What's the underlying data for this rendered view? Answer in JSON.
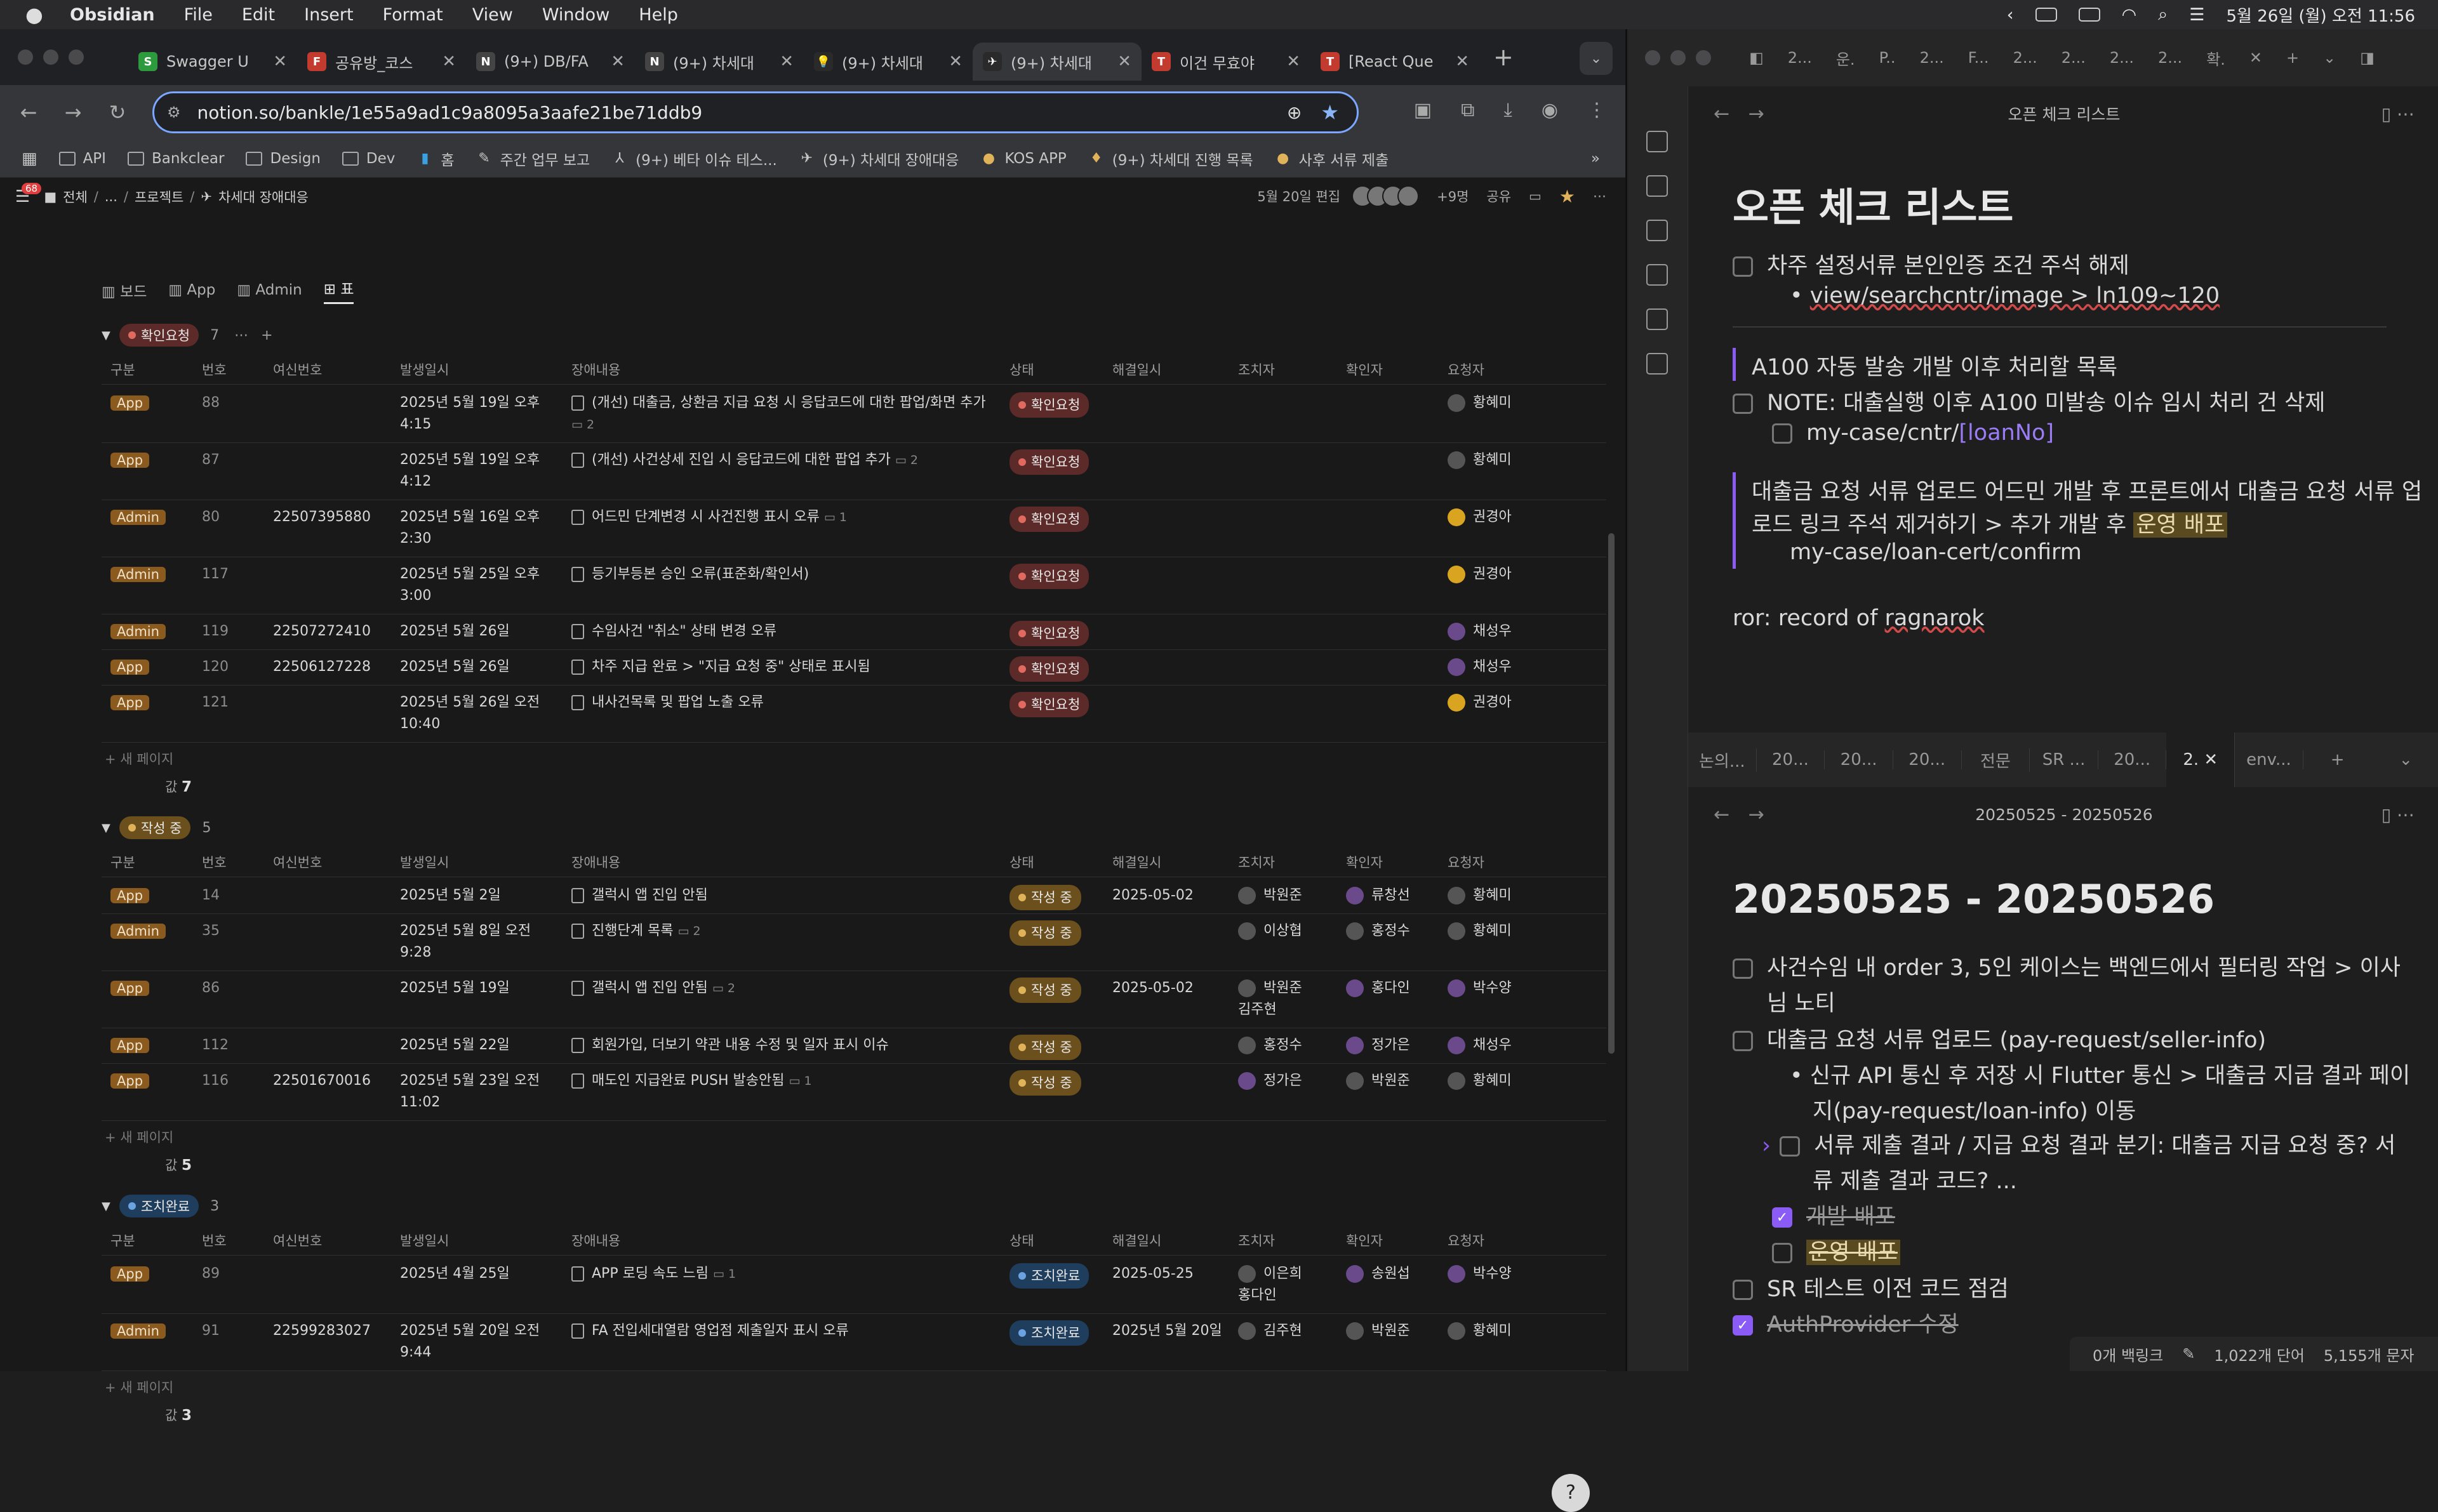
{
  "menubar": {
    "apple": "",
    "app": "Obsidian",
    "items": [
      "File",
      "Edit",
      "Insert",
      "Format",
      "View",
      "Window",
      "Help"
    ],
    "clock": "5월 26일 (월) 오전 11:56"
  },
  "chrome": {
    "tabs": [
      {
        "label": "Swagger U",
        "color": "#2e9a3e",
        "glyph": "S"
      },
      {
        "label": "공유방_코스",
        "color": "#c33a2f",
        "glyph": "F"
      },
      {
        "label": "(9+) DB/FA",
        "color": "#444",
        "glyph": "N"
      },
      {
        "label": "(9+) 차세대",
        "color": "#444",
        "glyph": "N"
      },
      {
        "label": "(9+) 차세대",
        "color": "#2a2a2a",
        "glyph": "💡"
      },
      {
        "label": "(9+) 차세대",
        "color": "#2a2a2a",
        "glyph": "✈",
        "active": true
      },
      {
        "label": "이건 무효야",
        "color": "#c33a2f",
        "glyph": "T"
      },
      {
        "label": "[React Que",
        "color": "#c33a2f",
        "glyph": "T"
      }
    ],
    "url": "notion.so/bankle/1e55a9ad1c9a8095a3aafe21be71ddb9",
    "bookmarks": [
      "API",
      "Bankclear",
      "Design",
      "Dev",
      "홈",
      "주간 업무 보고",
      "(9+) 베타 이슈 테스...",
      "(9+) 차세대 장애대응",
      "KOS APP",
      "(9+) 차세대 진행 목록",
      "사후 서류 제출"
    ]
  },
  "notion": {
    "badge": "68",
    "breadcrumb": [
      "전체",
      "...",
      "프로젝트",
      "차세대 장애대응"
    ],
    "edited": "5월 20일 편집",
    "more_people": "+9명",
    "share": "공유",
    "views": [
      "보드",
      "App",
      "Admin",
      "표"
    ],
    "columns": [
      "구분",
      "번호",
      "여신번호",
      "발생일시",
      "장애내용",
      "상태",
      "해결일시",
      "조치자",
      "확인자",
      "요청자"
    ],
    "new_page": "새 페이지",
    "count_label": "값",
    "groups": [
      {
        "name": "확인요청",
        "count": "7",
        "status_color": "red",
        "total": "7",
        "rows": [
          {
            "type": "App",
            "no": "88",
            "loan": "",
            "date": "2025년 5월 19일 오후\n4:15",
            "desc": "(개선) 대출금, 상환금 지급 요청 시 응답코드에 대한 팝업/화면 추가",
            "comments": "2",
            "status": "확인요청",
            "resolved": "",
            "actor": "",
            "checker": "",
            "requester": "황혜미",
            "req_av": "황"
          },
          {
            "type": "App",
            "no": "87",
            "loan": "",
            "date": "2025년 5월 19일 오후\n4:12",
            "desc": "(개선) 사건상세 진입 시 응답코드에 대한 팝업 추가",
            "comments": "2",
            "status": "확인요청",
            "resolved": "",
            "actor": "",
            "checker": "",
            "requester": "황혜미",
            "req_av": "황"
          },
          {
            "type": "Admin",
            "no": "80",
            "loan": "22507395880",
            "date": "2025년 5월 16일 오후\n2:30",
            "desc": "어드민 단계변경 시 사건진행 표시 오류",
            "comments": "1",
            "status": "확인요청",
            "resolved": "",
            "actor": "",
            "checker": "",
            "requester": "권경아",
            "req_av": "y"
          },
          {
            "type": "Admin",
            "no": "117",
            "loan": "",
            "date": "2025년 5월 25일 오후\n3:00",
            "desc": "등기부등본 승인 오류(표준화/확인서)",
            "comments": "",
            "status": "확인요청",
            "resolved": "",
            "actor": "",
            "checker": "",
            "requester": "권경아",
            "req_av": "y"
          },
          {
            "type": "Admin",
            "no": "119",
            "loan": "22507272410",
            "date": "2025년 5월 26일",
            "desc": "수임사건 \"취소\" 상태 변경 오류",
            "comments": "",
            "status": "확인요청",
            "resolved": "",
            "actor": "",
            "checker": "",
            "requester": "채성우",
            "req_av": "p"
          },
          {
            "type": "App",
            "no": "120",
            "loan": "22506127228",
            "date": "2025년 5월 26일",
            "desc": "차주 지급 완료 > \"지급 요청 중\" 상태로 표시됨",
            "comments": "",
            "status": "확인요청",
            "resolved": "",
            "actor": "",
            "checker": "",
            "requester": "채성우",
            "req_av": "p"
          },
          {
            "type": "App",
            "no": "121",
            "loan": "",
            "date": "2025년 5월 26일 오전\n10:40",
            "desc": "내사건목록 및 팝업 노출 오류",
            "comments": "",
            "status": "확인요청",
            "resolved": "",
            "actor": "",
            "checker": "",
            "requester": "권경아",
            "req_av": "y"
          }
        ]
      },
      {
        "name": "작성 중",
        "count": "5",
        "status_color": "yellow",
        "total": "5",
        "rows": [
          {
            "type": "App",
            "no": "14",
            "loan": "",
            "date": "2025년 5월 2일",
            "desc": "갤럭시 앱 진입 안됨",
            "comments": "",
            "status": "작성 중",
            "resolved": "2025-05-02",
            "actor": "박원준",
            "actor_av": "박",
            "checker": "류창선",
            "chk_av": "p",
            "requester": "황혜미",
            "req_av": "황"
          },
          {
            "type": "Admin",
            "no": "35",
            "loan": "",
            "date": "2025년 5월 8일 오전\n9:28",
            "desc": "진행단계 목록",
            "comments": "2",
            "status": "작성 중",
            "resolved": "",
            "actor": "이상협",
            "actor_av": "이",
            "checker": "홍정수",
            "chk_av": "홍",
            "requester": "황혜미",
            "req_av": "황"
          },
          {
            "type": "App",
            "no": "86",
            "loan": "",
            "date": "2025년 5월 19일",
            "desc": "갤럭시 앱 진입 안됨",
            "comments": "2",
            "status": "작성 중",
            "resolved": "2025-05-02",
            "actor": "박원준\n김주현",
            "actor_av": "박",
            "checker": "홍다인",
            "chk_av": "p",
            "requester": "박수양",
            "req_av": "p"
          },
          {
            "type": "App",
            "no": "112",
            "loan": "",
            "date": "2025년 5월 22일",
            "desc": "회원가입, 더보기 약관 내용 수정 및 일자 표시 이슈",
            "comments": "",
            "status": "작성 중",
            "resolved": "",
            "actor": "홍정수",
            "actor_av": "홍",
            "checker": "정가은",
            "chk_av": "p",
            "requester": "채성우",
            "req_av": "p"
          },
          {
            "type": "App",
            "no": "116",
            "loan": "22501670016",
            "date": "2025년 5월 23일 오전\n11:02",
            "desc": "매도인 지급완료 PUSH 발송안됨",
            "comments": "1",
            "status": "작성 중",
            "resolved": "",
            "actor": "정가은",
            "actor_av": "p",
            "checker": "박원준",
            "chk_av": "박",
            "requester": "황혜미",
            "req_av": "황"
          }
        ]
      },
      {
        "name": "조치완료",
        "count": "3",
        "status_color": "blue",
        "total": "3",
        "rows": [
          {
            "type": "App",
            "no": "89",
            "loan": "",
            "date": "2025년 4월 25일",
            "desc": "APP 로딩 속도 느림",
            "comments": "1",
            "status": "조치완료",
            "resolved": "2025-05-25",
            "actor": "이은희\n홍다인",
            "actor_av": "이",
            "checker": "송원섭",
            "chk_av": "p",
            "requester": "박수양",
            "req_av": "p"
          },
          {
            "type": "Admin",
            "no": "91",
            "loan": "22599283027",
            "date": "2025년 5월 20일 오전\n9:44",
            "desc": "FA 전입세대열람 영업점 제출일자 표시 오류",
            "comments": "",
            "status": "조치완료",
            "resolved": "2025년 5월 20일",
            "actor": "김주현",
            "actor_av": "김",
            "checker": "박원준",
            "chk_av": "박",
            "requester": "황혜미",
            "req_av": "황"
          }
        ]
      }
    ]
  },
  "obsidian": {
    "top_tabs": [
      "2...",
      "운.",
      "P..",
      "2...",
      "F...",
      "2...",
      "2...",
      "2...",
      "2...",
      "확."
    ],
    "pane1": {
      "header": "오픈 체크 리스트",
      "title": "오픈 체크 리스트",
      "l1": "차주 설정서류 본인인증 조건 주석 해제",
      "l2": "view/searchcntr/image > ln109~120",
      "l3": "A100 자동 발송 개발 이후 처리할 목록",
      "l4": "NOTE: 대출실행 이후 A100 미발송 이슈 임시 처리 건 삭제",
      "l5a": "my-case/cntr/",
      "l5b": "[loanNo]",
      "l6": "대출금 요청 서류 업로드 어드민 개발 후 프론트에서 대출금 요청 서류 업",
      "l7a": "로드 링크 주석 제거하기 > 추가 개발 후 ",
      "l7b": "운영 배포",
      "l8": "my-case/loan-cert/confirm",
      "l9a": "ror: record of ",
      "l9b": "ragnarok"
    },
    "mid_tabs": [
      "논의...",
      "20...",
      "20...",
      "20...",
      "전문",
      "SR ...",
      "20...",
      "2.",
      "env..."
    ],
    "pane2": {
      "header": "20250525 - 20250526",
      "title": "20250525 - 20250526",
      "a1": "사건수임 내 order 3, 5인 케이스는 백엔드에서 필터링 작업 > 이사",
      "a2": "님 노티",
      "b1": "대출금 요청 서류 업로드 (pay-request/seller-info)",
      "c1": "신규 API 통신 후 저장 시 Flutter 통신  > 대출금 지급 결과 페이",
      "c2": "지(pay-request/loan-info) 이동",
      "d1": "서류 제출 결과 / 지급 요청 결과 분기: 대출금 지급 요청 중? 서",
      "d2": "류 제출 결과 코드? ...",
      "e1": "개발 배포",
      "e2": "운영 배포",
      "f1": "SR 테스트 이전 코드 점검",
      "g1": "AuthProvider 수정"
    },
    "status": {
      "backlinks": "0개 백링크",
      "words": "1,022개 단어",
      "chars": "5,155개 문자"
    }
  }
}
